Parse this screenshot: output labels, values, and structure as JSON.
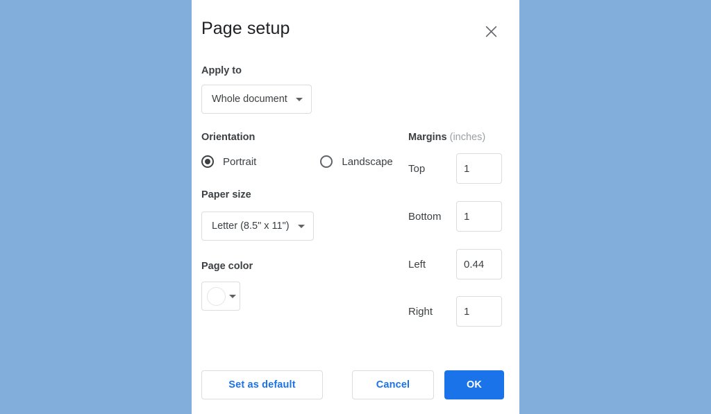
{
  "backdrop": {
    "color": "#82aedb"
  },
  "dialog": {
    "title": "Page setup",
    "close_icon": "close-icon",
    "apply_to": {
      "label": "Apply to",
      "value": "Whole document"
    },
    "orientation": {
      "label": "Orientation",
      "options": [
        {
          "label": "Portrait",
          "selected": true
        },
        {
          "label": "Landscape",
          "selected": false
        }
      ]
    },
    "paper_size": {
      "label": "Paper size",
      "value": "Letter (8.5\" x 11\")"
    },
    "page_color": {
      "label": "Page color",
      "swatch_color": "#ffffff"
    },
    "margins": {
      "heading": "Margins",
      "unit": "(inches)",
      "fields": [
        {
          "label": "Top",
          "value": "1"
        },
        {
          "label": "Bottom",
          "value": "1"
        },
        {
          "label": "Left",
          "value": "0.44"
        },
        {
          "label": "Right",
          "value": "1"
        }
      ]
    },
    "footer": {
      "set_default_label": "Set as default",
      "cancel_label": "Cancel",
      "ok_label": "OK",
      "accent_color": "#1a73e8"
    }
  }
}
